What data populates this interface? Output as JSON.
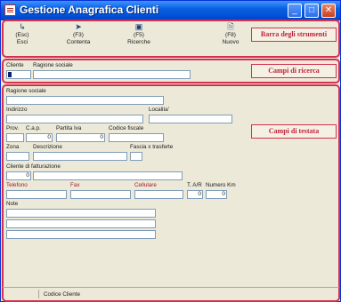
{
  "window": {
    "title": "Gestione Anagrafica Clienti",
    "controls": {
      "minimize": "_",
      "maximize": "□",
      "close": "✕"
    }
  },
  "toolbar": {
    "buttons": [
      {
        "key": "(Esc)",
        "label": "Esci",
        "icon": "exit-icon"
      },
      {
        "key": "(F3)",
        "label": "Contenta",
        "icon": "pointer-icon"
      },
      {
        "key": "(F5)",
        "label": "Ricerche",
        "icon": "search-window-icon"
      },
      {
        "key": "(F8)",
        "label": "Nuovo",
        "icon": "new-document-icon"
      }
    ]
  },
  "callouts": {
    "toolbar": "Barra degli strumenti",
    "search": "Campi di ricerca",
    "header": "Campi di testata"
  },
  "search": {
    "cliente_label": "Cliente",
    "ragione_label": "Ragione sociale",
    "cliente_value": "",
    "ragione_value": ""
  },
  "form": {
    "ragione_sociale": {
      "label": "Ragione sociale",
      "value": ""
    },
    "indirizzo": {
      "label": "Indirizzo",
      "value": ""
    },
    "localita": {
      "label": "Localita'",
      "value": ""
    },
    "prov": {
      "label": "Prov.",
      "value": ""
    },
    "cap": {
      "label": "C.a.p.",
      "value": "0"
    },
    "partita_iva": {
      "label": "Partita Iva",
      "value": "0"
    },
    "codice_fiscale": {
      "label": "Codice fiscale",
      "value": ""
    },
    "zona": {
      "label": "Zona",
      "value": ""
    },
    "descrizione": {
      "label": "Descrizione",
      "value": ""
    },
    "fascia": {
      "label": "Fascia x trasferte",
      "value": ""
    },
    "cliente_fatt": {
      "label": "Cliente di fatturazione",
      "value": "0"
    },
    "telefono": {
      "label": "Telefono",
      "value": ""
    },
    "fax": {
      "label": "Fax",
      "value": ""
    },
    "cellulare": {
      "label": "Cellulare",
      "value": ""
    },
    "tar": {
      "label": "T. A/R",
      "value": "0"
    },
    "numero_km": {
      "label": "Numero Km",
      "value": "0"
    },
    "note": {
      "label": "Note",
      "lines": [
        "",
        "",
        ""
      ]
    }
  },
  "statusbar": {
    "text": "Codice Cliente"
  }
}
